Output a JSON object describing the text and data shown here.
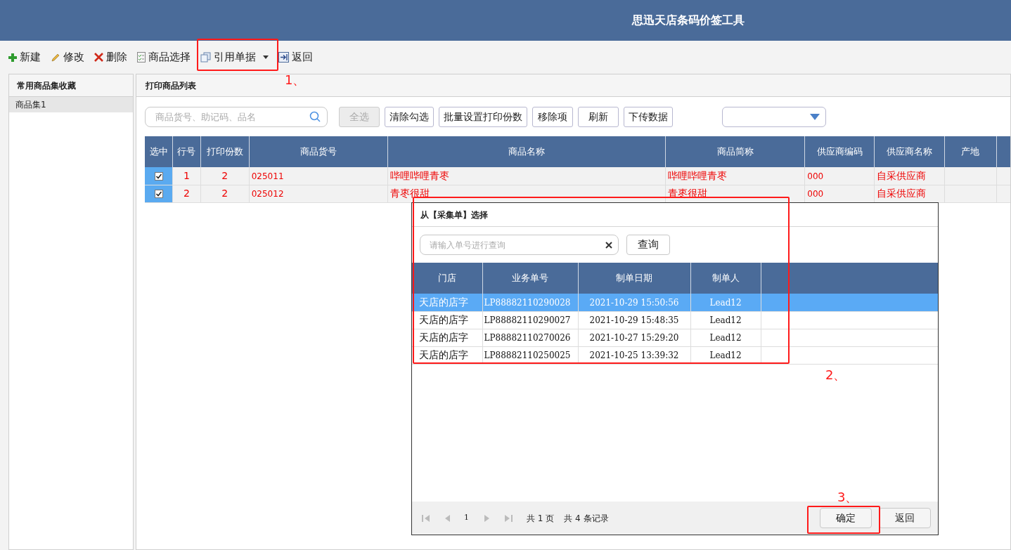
{
  "window": {
    "title": "思迅天店条码价签工具"
  },
  "toolbar": [
    {
      "kind": "plus",
      "label": "新建"
    },
    {
      "kind": "pencil",
      "label": "修改"
    },
    {
      "kind": "cross",
      "label": "删除"
    },
    {
      "kind": "checklist",
      "label": "商品选择"
    },
    {
      "kind": "copy",
      "label": "引用单据",
      "dropdown": true
    },
    {
      "kind": "exit",
      "label": "返回"
    }
  ],
  "sidebar": {
    "title": "常用商品集收藏",
    "items": [
      {
        "label": "商品集1",
        "selected": true
      }
    ]
  },
  "main": {
    "title": "打印商品列表",
    "search": {
      "placeholder": "商品货号、助记码、品名"
    },
    "buttons": [
      {
        "label": "全选",
        "disabled": true
      },
      {
        "label": "清除勾选",
        "disabled": false
      },
      {
        "label": "批量设置打印份数",
        "disabled": false
      },
      {
        "label": "移除项",
        "disabled": false
      },
      {
        "label": "刷新",
        "disabled": false
      },
      {
        "label": "下传数据",
        "disabled": false
      }
    ],
    "table": {
      "columns": [
        "选中",
        "行号",
        "打印份数",
        "商品货号",
        "商品名称",
        "商品简称",
        "供应商编码",
        "供应商名称",
        "产地"
      ],
      "rows": [
        {
          "checked": true,
          "cells": [
            "",
            "1",
            "2",
            "025011",
            "哔哩哔哩青枣",
            "哔哩哔哩青枣",
            "000",
            "自采供应商",
            ""
          ]
        },
        {
          "checked": true,
          "cells": [
            "",
            "2",
            "2",
            "025012",
            "青枣很甜",
            "青枣很甜",
            "000",
            "自采供应商",
            ""
          ]
        }
      ]
    }
  },
  "dialog": {
    "title": "从【采集单】选择",
    "search": {
      "placeholder": "请输入单号进行查询"
    },
    "query_button": "查询",
    "table": {
      "columns": [
        "门店",
        "业务单号",
        "制单日期",
        "制单人"
      ],
      "rows": [
        {
          "selected": true,
          "cells": [
            "天店的店字",
            "LP88882110290028",
            "2021-10-29 15:50:56",
            "Lead12"
          ]
        },
        {
          "selected": false,
          "cells": [
            "天店的店字",
            "LP88882110290027",
            "2021-10-29 15:48:35",
            "Lead12"
          ]
        },
        {
          "selected": false,
          "cells": [
            "天店的店字",
            "LP88882110270026",
            "2021-10-27 15:29:20",
            "Lead12"
          ]
        },
        {
          "selected": false,
          "cells": [
            "天店的店字",
            "LP88882110250025",
            "2021-10-25 13:39:32",
            "Lead12"
          ]
        }
      ]
    },
    "pager": {
      "page": "1",
      "pages": "共 1 页",
      "records": "共 4 条记录"
    },
    "buttons": [
      "确定",
      "返回"
    ]
  },
  "annotations": [
    "1、",
    "2、",
    "3、"
  ]
}
